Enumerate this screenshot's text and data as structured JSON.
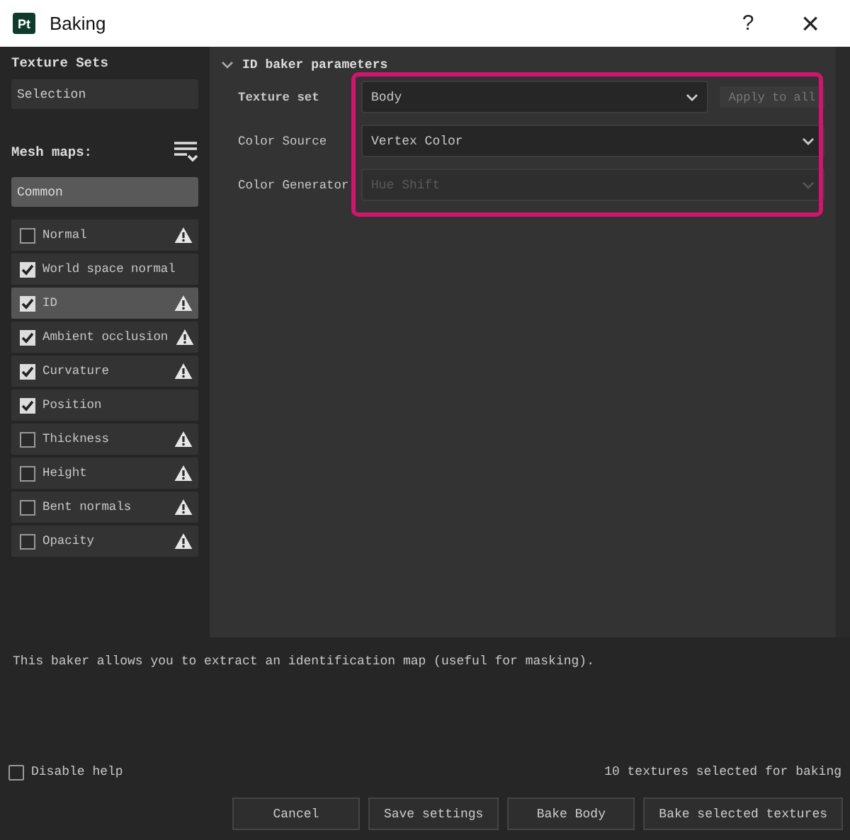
{
  "window": {
    "title": "Baking",
    "app_badge": "Pt",
    "help": "?",
    "close": "×"
  },
  "sidebar": {
    "texture_sets_label": "Texture Sets",
    "texture_set": "Selection",
    "mesh_maps_label": "Mesh maps:",
    "common": "Common",
    "mesh_maps": [
      {
        "label": "Normal",
        "checked": false,
        "selected": false,
        "warning": true
      },
      {
        "label": "World space normal",
        "checked": true,
        "selected": false,
        "warning": false
      },
      {
        "label": "ID",
        "checked": true,
        "selected": true,
        "warning": true
      },
      {
        "label": "Ambient occlusion",
        "checked": true,
        "selected": false,
        "warning": true
      },
      {
        "label": "Curvature",
        "checked": true,
        "selected": false,
        "warning": true
      },
      {
        "label": "Position",
        "checked": true,
        "selected": false,
        "warning": false
      },
      {
        "label": "Thickness",
        "checked": false,
        "selected": false,
        "warning": true
      },
      {
        "label": "Height",
        "checked": false,
        "selected": false,
        "warning": true
      },
      {
        "label": "Bent normals",
        "checked": false,
        "selected": false,
        "warning": true
      },
      {
        "label": "Opacity",
        "checked": false,
        "selected": false,
        "warning": true
      }
    ]
  },
  "parameters": {
    "title": "ID baker parameters",
    "expanded": true,
    "rows": [
      {
        "label": "Texture set",
        "value": "Body",
        "disabled": false,
        "button": "Apply to all"
      },
      {
        "label": "Color Source",
        "value": "Vertex Color",
        "disabled": false
      },
      {
        "label": "Color Generator",
        "value": "Hue Shift",
        "disabled": true
      }
    ]
  },
  "help_text": "This baker allows you to extract an identification map (useful for masking).",
  "disable_help": {
    "label": "Disable help",
    "checked": false
  },
  "status": "10 textures selected for baking",
  "buttons": [
    "Cancel",
    "Save settings",
    "Bake Body",
    "Bake selected textures"
  ]
}
